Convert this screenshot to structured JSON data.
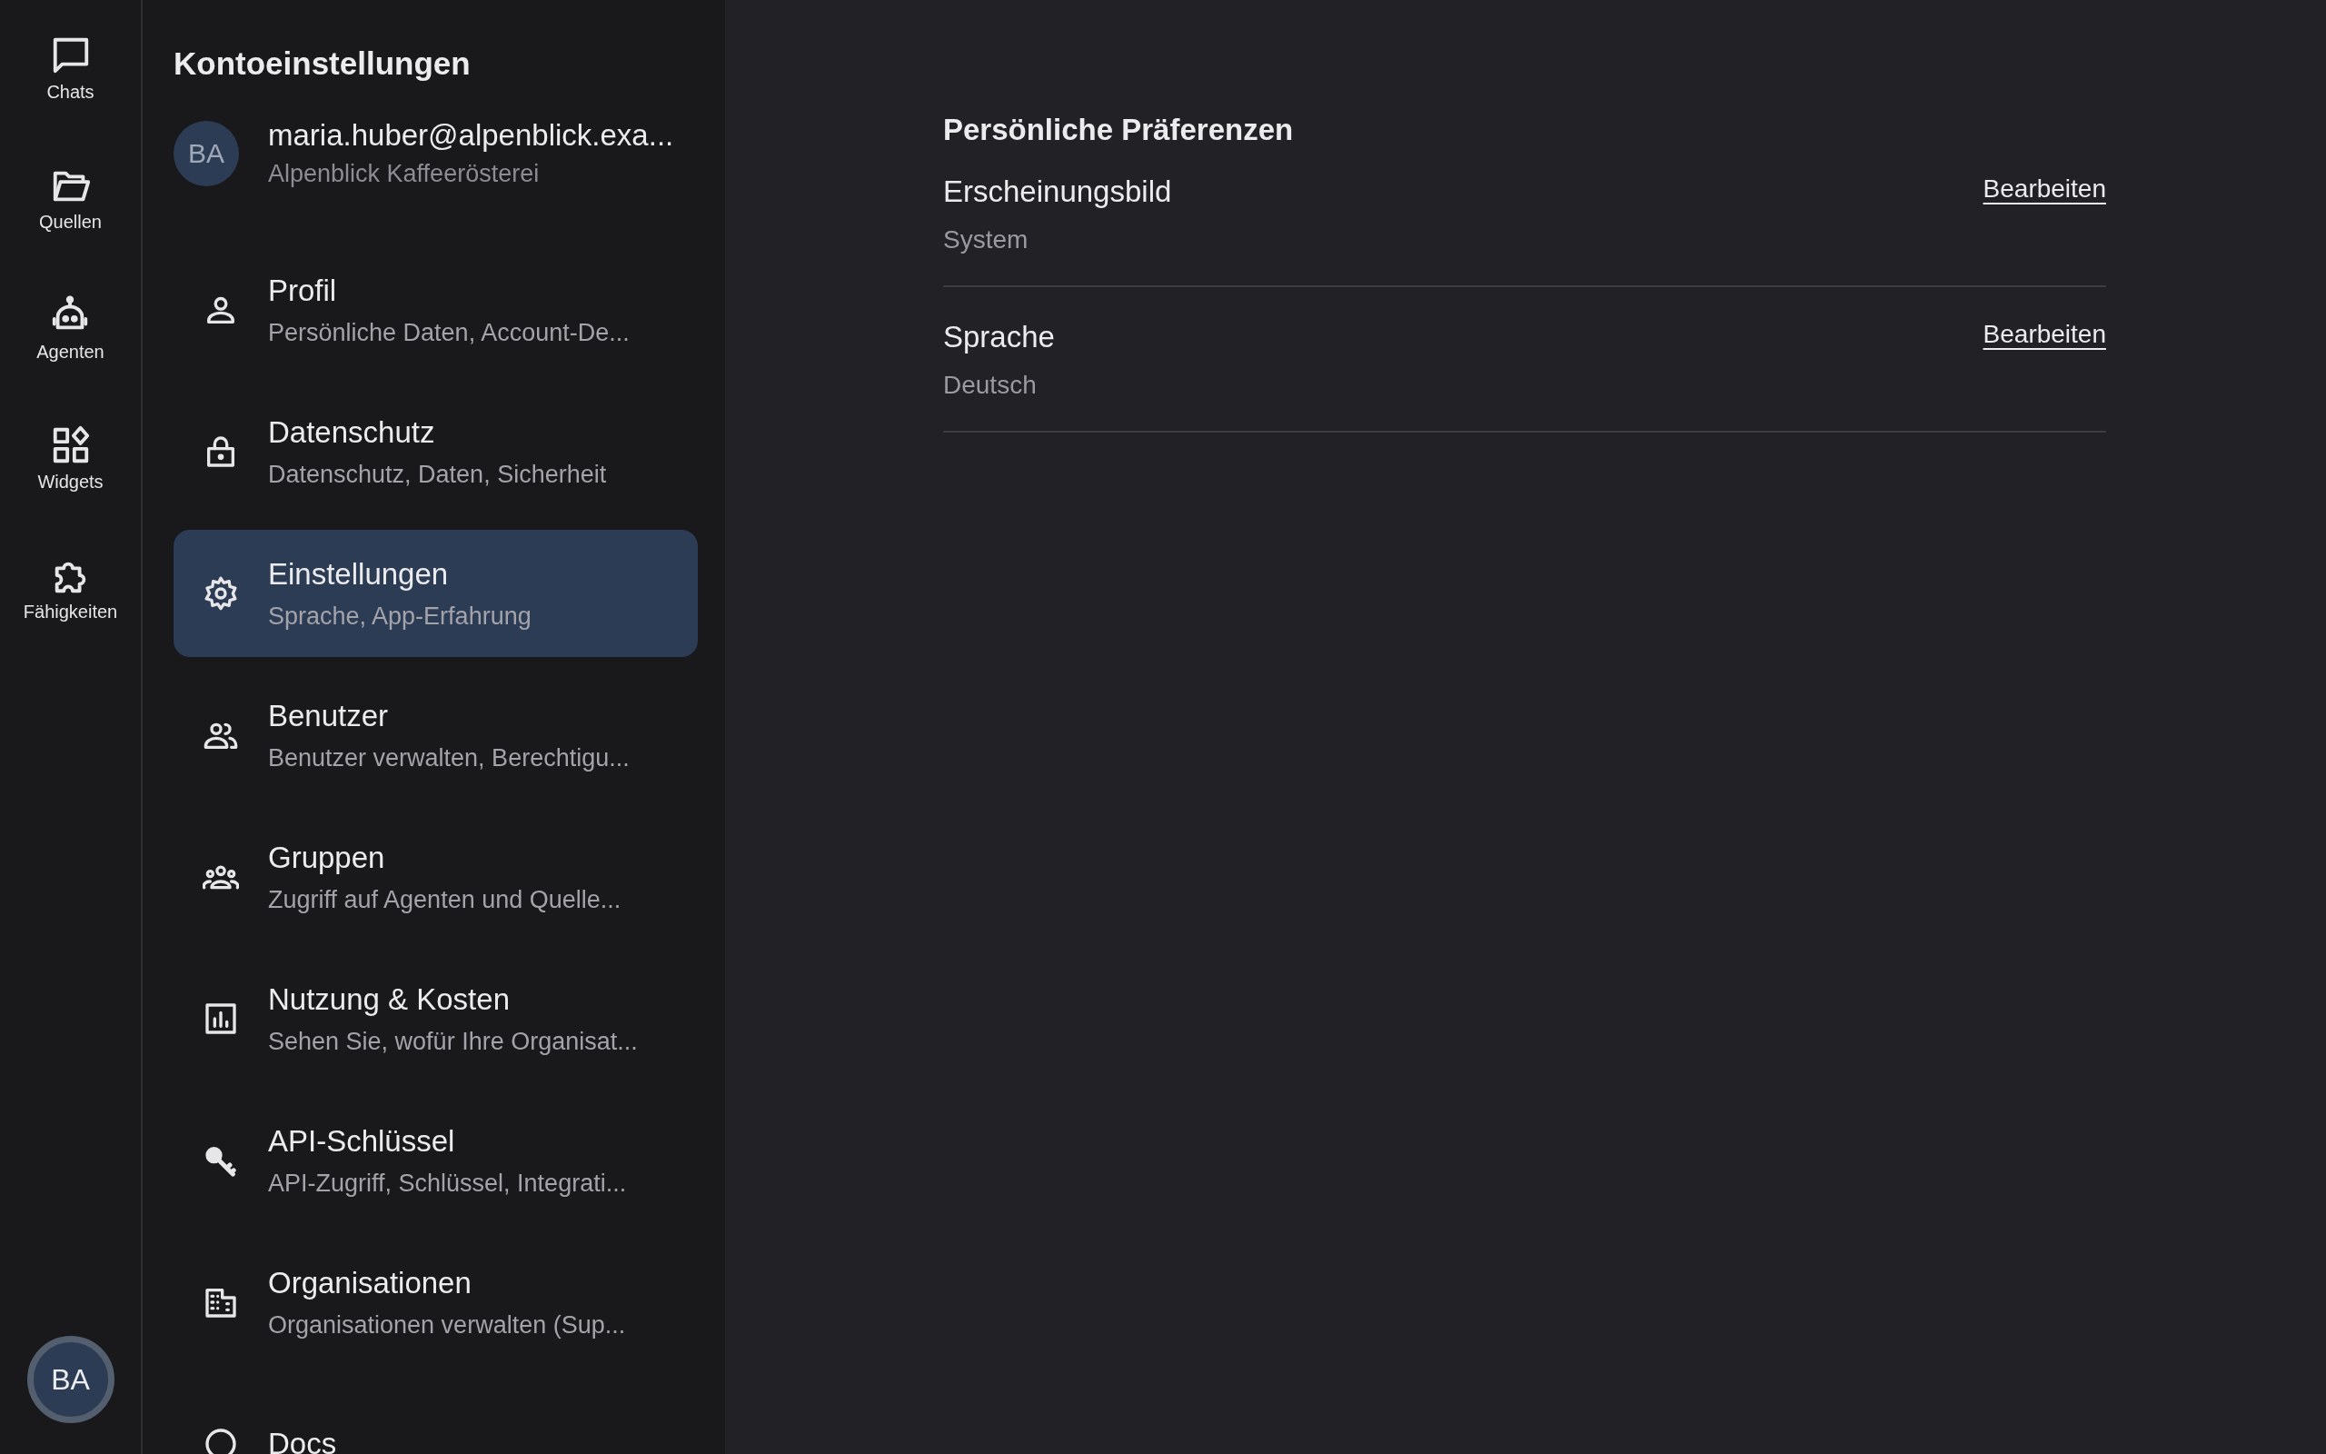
{
  "rail": {
    "items": [
      {
        "label": "Chats"
      },
      {
        "label": "Quellen"
      },
      {
        "label": "Agenten"
      },
      {
        "label": "Widgets"
      },
      {
        "label": "Fähigkeiten"
      }
    ],
    "avatar": {
      "initials": "BA"
    }
  },
  "sidebar": {
    "title": "Kontoeinstellungen",
    "account": {
      "initials": "BA",
      "email": "maria.huber@alpenblick.exa...",
      "organization": "Alpenblick Kaffeerösterei"
    },
    "items": [
      {
        "title": "Profil",
        "subtitle": "Persönliche Daten, Account-De...",
        "selected": false
      },
      {
        "title": "Datenschutz",
        "subtitle": "Datenschutz, Daten, Sicherheit",
        "selected": false
      },
      {
        "title": "Einstellungen",
        "subtitle": "Sprache, App-Erfahrung",
        "selected": true
      },
      {
        "title": "Benutzer",
        "subtitle": "Benutzer verwalten, Berechtigu...",
        "selected": false
      },
      {
        "title": "Gruppen",
        "subtitle": "Zugriff auf Agenten und Quelle...",
        "selected": false
      },
      {
        "title": "Nutzung & Kosten",
        "subtitle": "Sehen Sie, wofür Ihre Organisat...",
        "selected": false
      },
      {
        "title": "API-Schlüssel",
        "subtitle": "API-Zugriff, Schlüssel, Integrati...",
        "selected": false
      },
      {
        "title": "Organisationen",
        "subtitle": "Organisationen verwalten (Sup...",
        "selected": false
      },
      {
        "title": "Docs",
        "selected": false
      }
    ]
  },
  "main": {
    "heading": "Persönliche Präferenzen",
    "settings": [
      {
        "label": "Erscheinungsbild",
        "value": "System",
        "action": "Bearbeiten"
      },
      {
        "label": "Sprache",
        "value": "Deutsch",
        "action": "Bearbeiten"
      }
    ]
  }
}
